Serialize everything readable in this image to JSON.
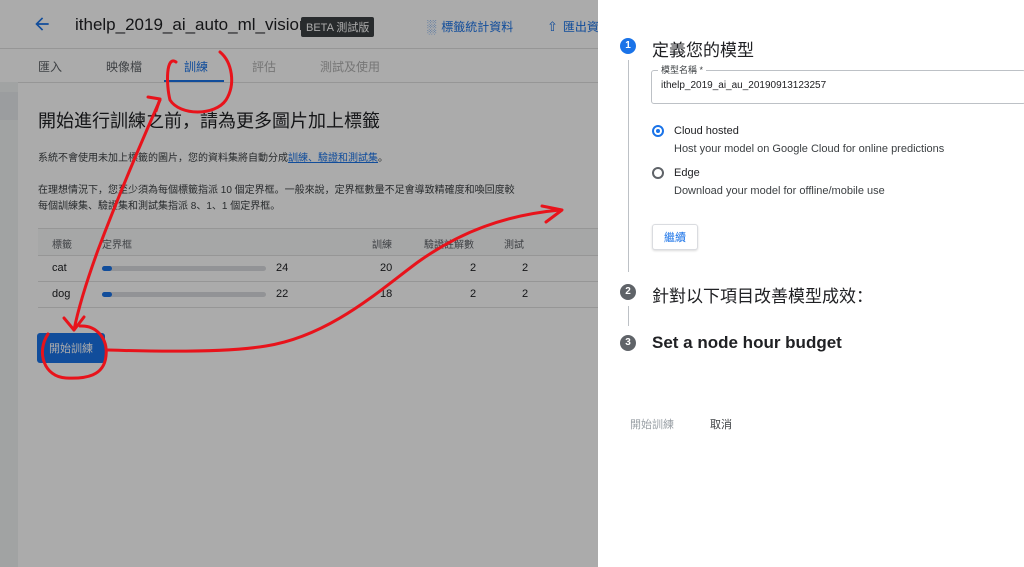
{
  "header": {
    "title": "ithelp_2019_ai_auto_ml_vision",
    "badge": "BETA 測試版",
    "actions": [
      {
        "icon": "bar-chart-icon",
        "label": "標籤統計資料"
      },
      {
        "icon": "upload-icon",
        "label": "匯出資"
      }
    ]
  },
  "tabs": [
    {
      "label": "匯入",
      "state": "normal"
    },
    {
      "label": "映像檔",
      "state": "normal"
    },
    {
      "label": "訓練",
      "state": "active"
    },
    {
      "label": "評估",
      "state": "disabled"
    },
    {
      "label": "測試及使用",
      "state": "disabled"
    }
  ],
  "main": {
    "heading": "開始進行訓練之前，請為更多圖片加上標籤",
    "para1_text": "系統不會使用未加上標籤的圖片，您的資料集將自動分成",
    "para1_link": "訓練、驗證和測試集",
    "para1_end": "。",
    "para2_line1": "在理想情況下，您至少須為每個標籤指派 10 個定界框。一般來說，定界框數量不足會導致精確度和喚回度較",
    "para2_line2": "每個訓練集、驗證集和測試集指派 8、1、1 個定界框。",
    "table": {
      "headers": {
        "label": "標籤",
        "boxes": "定界框",
        "train": "訓練",
        "validate": "驗證註解數",
        "test": "測試"
      },
      "rows": [
        {
          "label": "cat",
          "boxes": "24",
          "box_fill": 0.06,
          "train": "20",
          "validate": "2",
          "test": "2"
        },
        {
          "label": "dog",
          "boxes": "22",
          "box_fill": 0.06,
          "train": "18",
          "validate": "2",
          "test": "2"
        }
      ]
    },
    "start_button": "開始訓練"
  },
  "panel": {
    "step1": {
      "number": "1",
      "title": "定義您的模型"
    },
    "model_name_label": "模型名稱 *",
    "model_name_value": "ithelp_2019_ai_au_20190913123257",
    "options": [
      {
        "title": "Cloud hosted",
        "desc": "Host your model on Google Cloud for online predictions",
        "checked": true
      },
      {
        "title": "Edge",
        "desc": "Download your model for offline/mobile use",
        "checked": false
      }
    ],
    "continue_button": "繼續",
    "step2": {
      "number": "2",
      "title": "針對以下項目改善模型成效："
    },
    "step3": {
      "number": "3",
      "title": "Set a node hour budget"
    },
    "footer": {
      "start": "開始訓練",
      "cancel": "取消"
    }
  },
  "colors": {
    "accent": "#1a73e8",
    "annotation": "#e8131b",
    "step_inactive": "#5f6368",
    "overlay": "rgba(0,0,0,0.33)"
  }
}
